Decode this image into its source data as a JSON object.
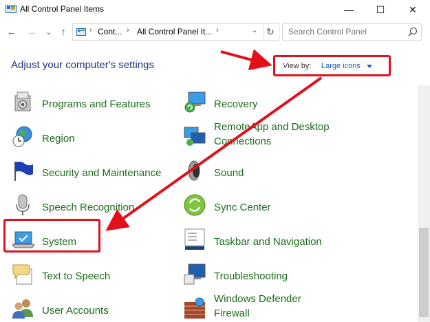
{
  "window": {
    "title": "All Control Panel Items",
    "minimize_glyph": "—",
    "maximize_glyph": "☐",
    "close_glyph": "✕"
  },
  "nav": {
    "back_glyph": "←",
    "forward_glyph": "→",
    "recent_glyph": "⌄",
    "up_glyph": "↑",
    "refresh_glyph": "↻"
  },
  "address": {
    "crumbs": [
      "Cont...",
      "All Control Panel It..."
    ],
    "separator_glyph": "›"
  },
  "search": {
    "placeholder": "Search Control Panel",
    "value": ""
  },
  "page": {
    "heading": "Adjust your computer's settings"
  },
  "view_by": {
    "label": "View by:",
    "value": "Large icons"
  },
  "items_left": [
    {
      "label": "Programs and Features",
      "icon": "programs-features-icon"
    },
    {
      "label": "Region",
      "icon": "region-globe-clock-icon"
    },
    {
      "label": "Security and Maintenance",
      "icon": "flag-icon"
    },
    {
      "label": "Speech Recognition",
      "icon": "microphone-icon"
    },
    {
      "label": "System",
      "icon": "laptop-icon"
    },
    {
      "label": "Text to Speech",
      "icon": "speech-bubble-icon"
    },
    {
      "label": "User Accounts",
      "icon": "users-icon"
    }
  ],
  "items_right": [
    {
      "label": "Recovery",
      "icon": "recovery-icon"
    },
    {
      "label_line1": "RemoteApp and Desktop",
      "label_line2": "Connections",
      "icon": "remoteapp-icon"
    },
    {
      "label": "Sound",
      "icon": "speaker-icon"
    },
    {
      "label": "Sync Center",
      "icon": "sync-icon"
    },
    {
      "label": "Taskbar and Navigation",
      "icon": "taskbar-icon"
    },
    {
      "label": "Troubleshooting",
      "icon": "troubleshooting-icon"
    },
    {
      "label_line1": "Windows Defender",
      "label_line2": "Firewall",
      "icon": "firewall-icon"
    }
  ],
  "colors": {
    "link_green": "#1a6b1a",
    "heading_blue": "#1e3287",
    "accent_blue": "#1a56c8",
    "annotation_red": "#e1101b"
  }
}
